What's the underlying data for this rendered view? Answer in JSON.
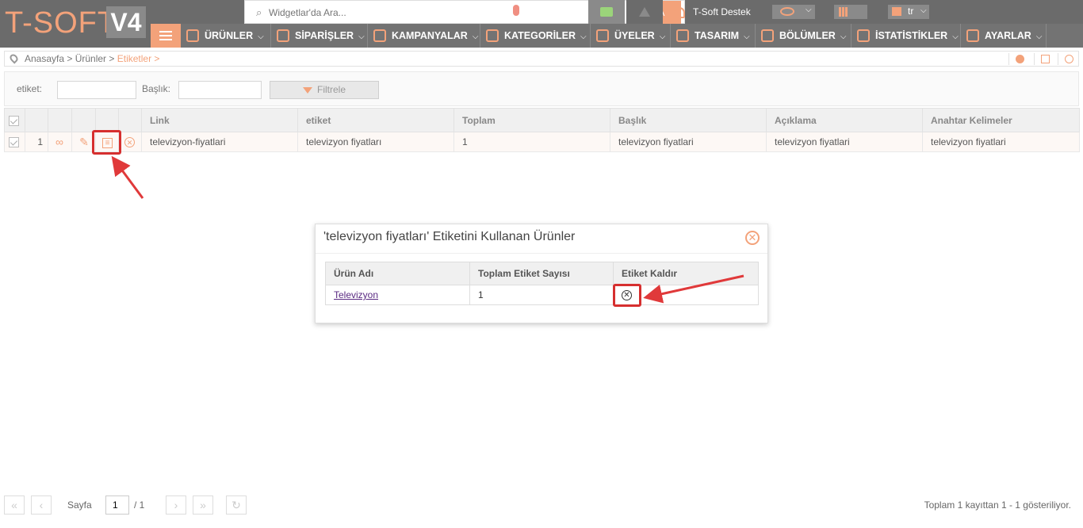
{
  "app": {
    "logo_text": "T-SOFT",
    "logo_version": "V4"
  },
  "topbar": {
    "search_placeholder": "Widgetlar'da Ara...",
    "search_button": "ARA",
    "support_label": "T-Soft Destek",
    "language": "tr"
  },
  "nav": {
    "items": [
      {
        "label": "ÜRÜNLER"
      },
      {
        "label": "SİPARİŞLER"
      },
      {
        "label": "KAMPANYALAR"
      },
      {
        "label": "KATEGORİLER"
      },
      {
        "label": "ÜYELER"
      },
      {
        "label": "TASARIM"
      },
      {
        "label": "BÖLÜMLER"
      },
      {
        "label": "İSTATİSTİKLER"
      },
      {
        "label": "AYARLAR"
      }
    ]
  },
  "breadcrumb": {
    "path": "Anasayfa > Ürünler > ",
    "current": "Etiketler >"
  },
  "filter": {
    "etiket_label": "etiket:",
    "baslik_label": "Başlık:",
    "etiket_value": "",
    "baslik_value": "",
    "button_label": "Filtrele"
  },
  "grid": {
    "columns": [
      "Link",
      "etiket",
      "Toplam",
      "Başlık",
      "Açıklama",
      "Anahtar Kelimeler"
    ],
    "rows": [
      {
        "index": "1",
        "link": "televizyon-fiyatlari",
        "etiket": "televizyon fiyatları",
        "toplam": "1",
        "baslik": "televizyon fiyatlari",
        "aciklama": "televizyon fiyatlari",
        "anahtar": "televizyon fiyatlari"
      }
    ]
  },
  "modal": {
    "title": "'televizyon fiyatları' Etiketini Kullanan Ürünler",
    "columns": [
      "Ürün Adı",
      "Toplam Etiket Sayısı",
      "Etiket Kaldır"
    ],
    "rows": [
      {
        "product": "Televizyon",
        "count": "1"
      }
    ]
  },
  "pager": {
    "page_label": "Sayfa",
    "page_value": "1",
    "total_pages": "/ 1",
    "summary": "Toplam 1 kayıttan 1 - 1 gösteriliyor."
  },
  "colors": {
    "accent": "#f3a27a",
    "topbar": "#6b6b6b",
    "highlight": "#d62f2f"
  }
}
